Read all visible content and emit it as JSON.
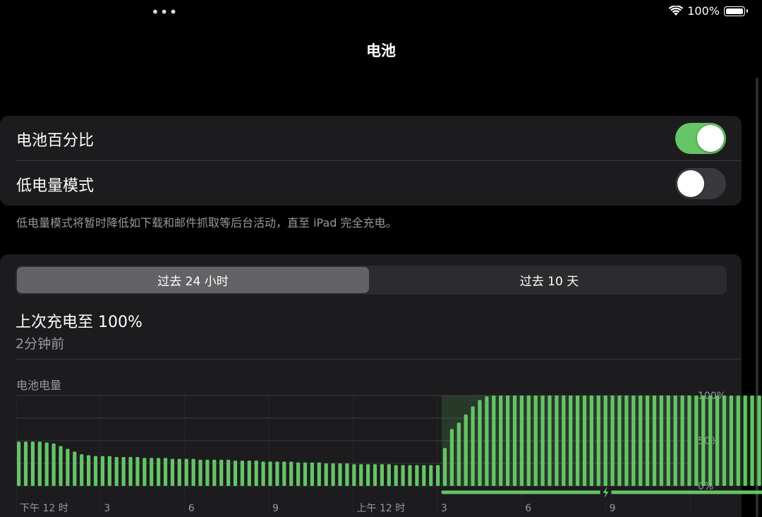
{
  "status_bar": {
    "dots": "•••",
    "battery_percent": "100%"
  },
  "title": "电池",
  "settings": {
    "battery_percentage": {
      "label": "电池百分比",
      "on": true
    },
    "low_power_mode": {
      "label": "低电量模式",
      "on": false
    }
  },
  "footnote": "低电量模式将暂时降低如下载和邮件抓取等后台活动，直至 iPad 完全充电。",
  "segment": {
    "tabs": [
      "过去 24 小时",
      "过去 10 天"
    ],
    "selected": 0
  },
  "last_charged": {
    "title": "上次充电至 100%",
    "subtitle": "2分钟前"
  },
  "chart_data": {
    "type": "bar",
    "title": "电池电量",
    "ylabel": "",
    "ylim": [
      0,
      100
    ],
    "y_ticks": [
      "100%",
      "50%",
      "0%"
    ],
    "x_tick_labels": [
      "下午 12 时",
      "3",
      "6",
      "9",
      "上午 12 时",
      "3",
      "6",
      "9"
    ],
    "color": "#65c466",
    "charging_color": "#65c466",
    "values": [
      49,
      49,
      49,
      49,
      48,
      47,
      44,
      41,
      38,
      35,
      34,
      33,
      33,
      33,
      32,
      32,
      32,
      32,
      31,
      31,
      31,
      31,
      30,
      30,
      30,
      30,
      29,
      29,
      29,
      29,
      29,
      28,
      28,
      28,
      28,
      27,
      27,
      27,
      27,
      27,
      26,
      26,
      26,
      26,
      25,
      25,
      25,
      25,
      24,
      24,
      24,
      24,
      24,
      24,
      23,
      23,
      23,
      23,
      23,
      23,
      23,
      42,
      63,
      70,
      79,
      88,
      95,
      99,
      100,
      100,
      100,
      100,
      100,
      100,
      100,
      100,
      100,
      100,
      100,
      100,
      100,
      100,
      100,
      100,
      100,
      100,
      100,
      100,
      100,
      100,
      100,
      100,
      100,
      100,
      100,
      100,
      100,
      100,
      100,
      100,
      100,
      100,
      100,
      100,
      100,
      100,
      100,
      100
    ],
    "charging_start_index": 61,
    "charging_end_index": 107
  }
}
